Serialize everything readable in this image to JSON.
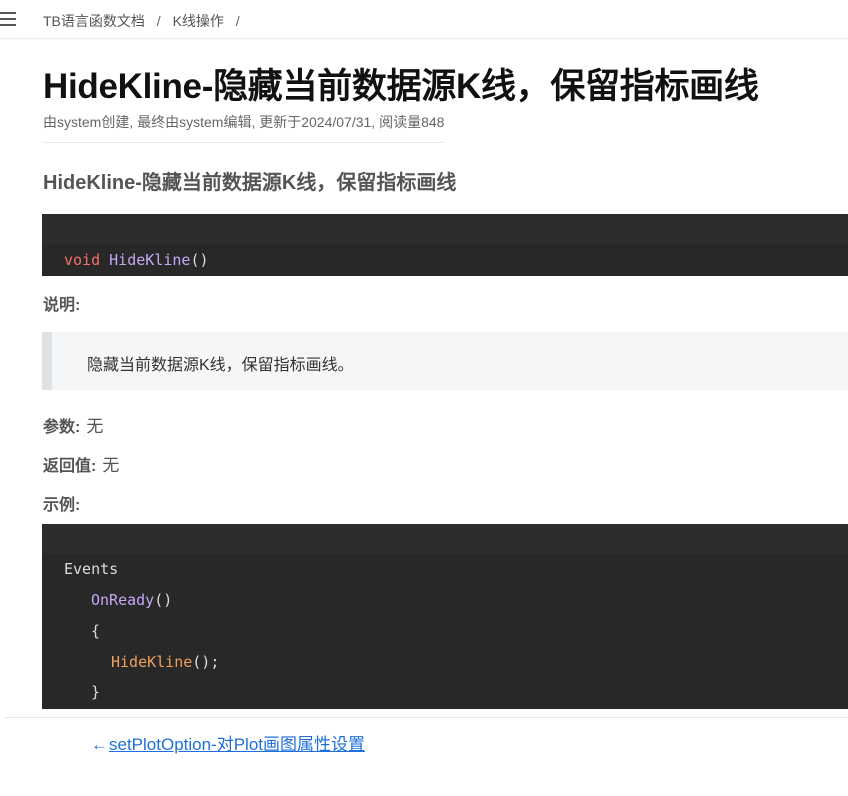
{
  "breadcrumb": {
    "items": [
      "TB语言函数文档",
      "K线操作"
    ],
    "separator": "/"
  },
  "page": {
    "title": "HideKline-隐藏当前数据源K线，保留指标画线",
    "meta": "由system创建, 最终由system编辑, 更新于2024/07/31, 阅读量848",
    "section_heading": "HideKline-隐藏当前数据源K线，保留指标画线"
  },
  "signature": {
    "keyword": "void",
    "function": "HideKline",
    "parens": "()"
  },
  "description": {
    "label": "说明:",
    "text": "隐藏当前数据源K线，保留指标画线。"
  },
  "params": {
    "label": "参数:",
    "value": "无"
  },
  "returns": {
    "label": "返回值:",
    "value": "无"
  },
  "example": {
    "label": "示例:",
    "lines": {
      "l1": "Events",
      "l2_fn": "OnReady",
      "l2_rest": "()",
      "l3": "{",
      "l4_fn": "HideKline",
      "l4_rest": "();",
      "l5": "}"
    }
  },
  "nav": {
    "prev_arrow": "←",
    "prev_label": "setPlotOption-对Plot画图属性设置"
  },
  "colors": {
    "code_bg": "#282828",
    "keyword": "#f47067",
    "function": "#c4a7f5",
    "call": "#f0a05a",
    "link": "#1e6fdb"
  },
  "icons": {
    "menu": "hamburger-menu-icon"
  }
}
